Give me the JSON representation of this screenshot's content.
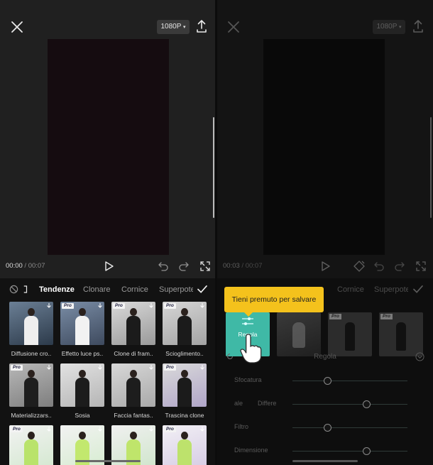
{
  "left": {
    "resolution": "1080P",
    "time_current": "00:00",
    "time_separator": " / ",
    "time_total": "00:07",
    "tabs": [
      "Tendenze",
      "Clonare",
      "Cornice",
      "Superpote"
    ],
    "tab_active": "Tendenze",
    "tiles": [
      {
        "caption": "Diffusione cro..",
        "pro": false
      },
      {
        "caption": "Effetto luce ps..",
        "pro": true
      },
      {
        "caption": "Clone di fram..",
        "pro": true
      },
      {
        "caption": "Scioglimento..",
        "pro": true
      },
      {
        "caption": "Materializzars..",
        "pro": true
      },
      {
        "caption": "Sosia",
        "pro": false
      },
      {
        "caption": "Faccia fantas..",
        "pro": false
      },
      {
        "caption": "Trascina clone",
        "pro": true
      },
      {
        "caption": "",
        "pro": true
      },
      {
        "caption": "",
        "pro": false
      },
      {
        "caption": "",
        "pro": false
      },
      {
        "caption": "",
        "pro": true
      }
    ],
    "pro_label": "Pro"
  },
  "right": {
    "resolution": "1080P",
    "time_current": "00:03",
    "time_separator": " / ",
    "time_total": "00:07",
    "tabs": [
      "Cornice",
      "Superpote"
    ],
    "tooltip": "Tieni premuto per salvare",
    "selected_tile_label": "Regola",
    "section_title": "Regola",
    "sliders": [
      {
        "label": "Sfocatura",
        "value": 0.3
      },
      {
        "label": "ale",
        "sub_label": "Differe",
        "value": 0.64
      },
      {
        "label": "Filtro",
        "value": 0.3
      },
      {
        "label": "Dimensione",
        "value": 0.64
      }
    ],
    "pro_label": "Pro"
  },
  "colors": {
    "accent_yellow": "#f4c21c",
    "teal": "#3fb9a6"
  }
}
